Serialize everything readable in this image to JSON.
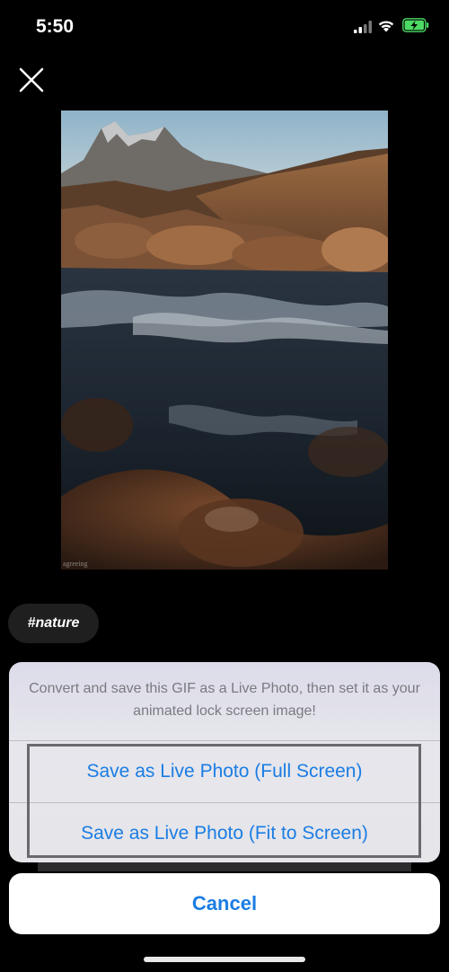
{
  "status_bar": {
    "time": "5:50",
    "signal_icon": "cellular-signal-icon",
    "wifi_icon": "wifi-icon",
    "battery_icon": "battery-charging-icon",
    "battery_color": "#4cd964"
  },
  "close": {
    "icon": "close-icon"
  },
  "media": {
    "watermark": "agreeing"
  },
  "hashtag": {
    "label": "#nature"
  },
  "action_sheet": {
    "message": "Convert and save this GIF as a Live Photo, then set it as your animated lock screen image!",
    "options": [
      {
        "label": "Save as Live Photo (Full Screen)"
      },
      {
        "label": "Save as Live Photo (Fit to Screen)"
      }
    ],
    "cancel_label": "Cancel",
    "accent_color": "#1b7de3"
  }
}
